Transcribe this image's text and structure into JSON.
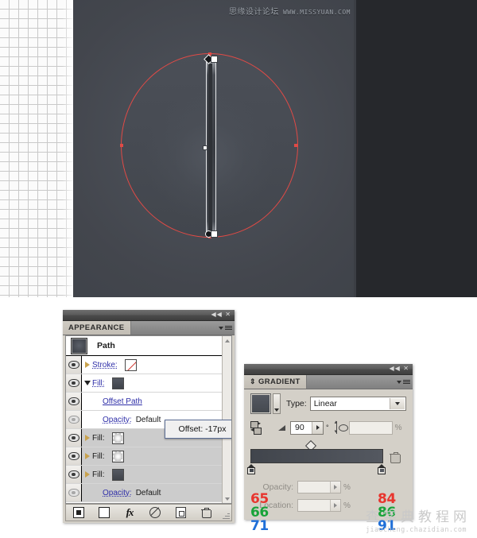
{
  "watermarks": {
    "top_cn": "思缘设计论坛",
    "top_url": "WWW.MISSYUAN.COM",
    "bottom_cn": "查字典教程网",
    "bottom_url": "jiaocheng.chazidian.com"
  },
  "canvas": {
    "artboard_bg": "#474b52",
    "path_color": "#e04a46",
    "right_panel_bg": "#26282c"
  },
  "appearance_panel": {
    "tab_label": "APPEARANCE",
    "collapse_glyph": "◀◀",
    "close_glyph": "✕",
    "target_label": "Path",
    "rows": [
      {
        "label": "Stroke:",
        "value": "",
        "swatch": "none",
        "disclosure": "right",
        "eye": "on",
        "selected": false
      },
      {
        "label": "Fill:",
        "value": "",
        "swatch": "dark",
        "disclosure": "down",
        "eye": "on",
        "selected": false
      },
      {
        "label": "Offset Path",
        "value": "",
        "swatch": "",
        "disclosure": "none",
        "eye": "on",
        "selected": false
      },
      {
        "label": "Opacity:",
        "value": "Default",
        "swatch": "",
        "disclosure": "none",
        "eye": "dim",
        "selected": false
      },
      {
        "label": "Fill:",
        "value": "",
        "swatch": "radial",
        "disclosure": "right",
        "eye": "on",
        "selected": true
      },
      {
        "label": "Fill:",
        "value": "",
        "swatch": "radial",
        "disclosure": "right",
        "eye": "on",
        "selected": true
      },
      {
        "label": "Fill:",
        "value": "",
        "swatch": "dark",
        "disclosure": "right",
        "eye": "on",
        "selected": true
      },
      {
        "label": "Opacity:",
        "value": "Default",
        "swatch": "",
        "disclosure": "none",
        "eye": "dim",
        "selected": true
      }
    ],
    "offset_tooltip": "Offset: -17px",
    "toolbar": {
      "new_art_label": "new-art-with-appearance",
      "clear_label": "clear-appearance",
      "fx_label": "fx",
      "no_effect_label": "remove-effect",
      "duplicate_label": "duplicate-item",
      "delete_label": "delete-item"
    }
  },
  "gradient_panel": {
    "tab_label": "GRADIENT",
    "drag_glyph": "⇕",
    "collapse_glyph": "◀◀",
    "close_glyph": "✕",
    "type_label": "Type:",
    "type_value": "Linear",
    "angle_value": "90",
    "angle_unit": "°",
    "aspect_value": "",
    "aspect_unit": "%",
    "opacity_label": "Opacity:",
    "opacity_value": "",
    "opacity_unit": "%",
    "location_label": "Location:",
    "location_value": "",
    "location_unit": "%",
    "stop_left_color": "#41454c",
    "stop_right_color": "#545860",
    "rgb_left": {
      "r": "65",
      "g": "66",
      "b": "71"
    },
    "rgb_right": {
      "r": "84",
      "g": "86",
      "b": "91"
    }
  }
}
